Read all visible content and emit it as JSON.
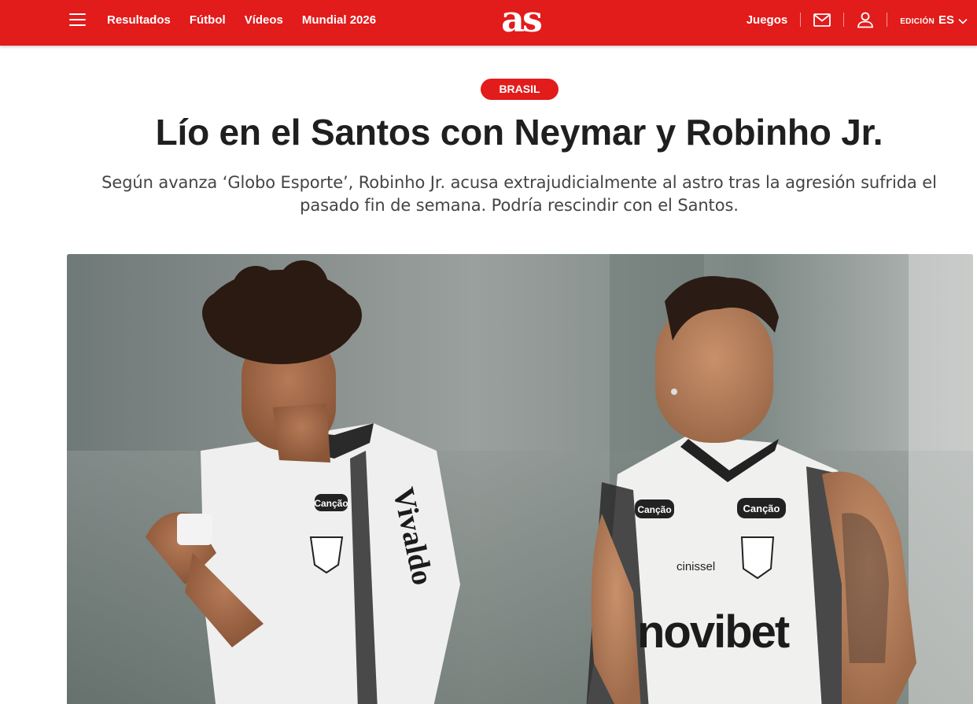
{
  "header": {
    "nav_items": [
      "Resultados",
      "Fútbol",
      "Vídeos",
      "Mundial 2026"
    ],
    "logo_text": "as",
    "juegos_label": "Juegos",
    "edition_label": "EDICIÓN",
    "edition_code": "ES",
    "brand_color": "#e21b1b"
  },
  "icons": [
    "menu-icon",
    "mail-icon",
    "user-icon",
    "chevron-down-icon"
  ],
  "article": {
    "kicker": "BRASIL",
    "headline": "Lío en el Santos con Neymar y Robinho Jr.",
    "subtitle": "Según avanza ‘Globo Esporte’, Robinho Jr. acusa extrajudicialmente al astro tras la agresión sufrida el pasado fin de semana. Podría rescindir con el Santos."
  },
  "photo": {
    "left_shirt_sponsor": "Vivaldo",
    "badge_text": "Canção",
    "kit_maker": "cinissel",
    "chest_sponsor": "novibet"
  }
}
